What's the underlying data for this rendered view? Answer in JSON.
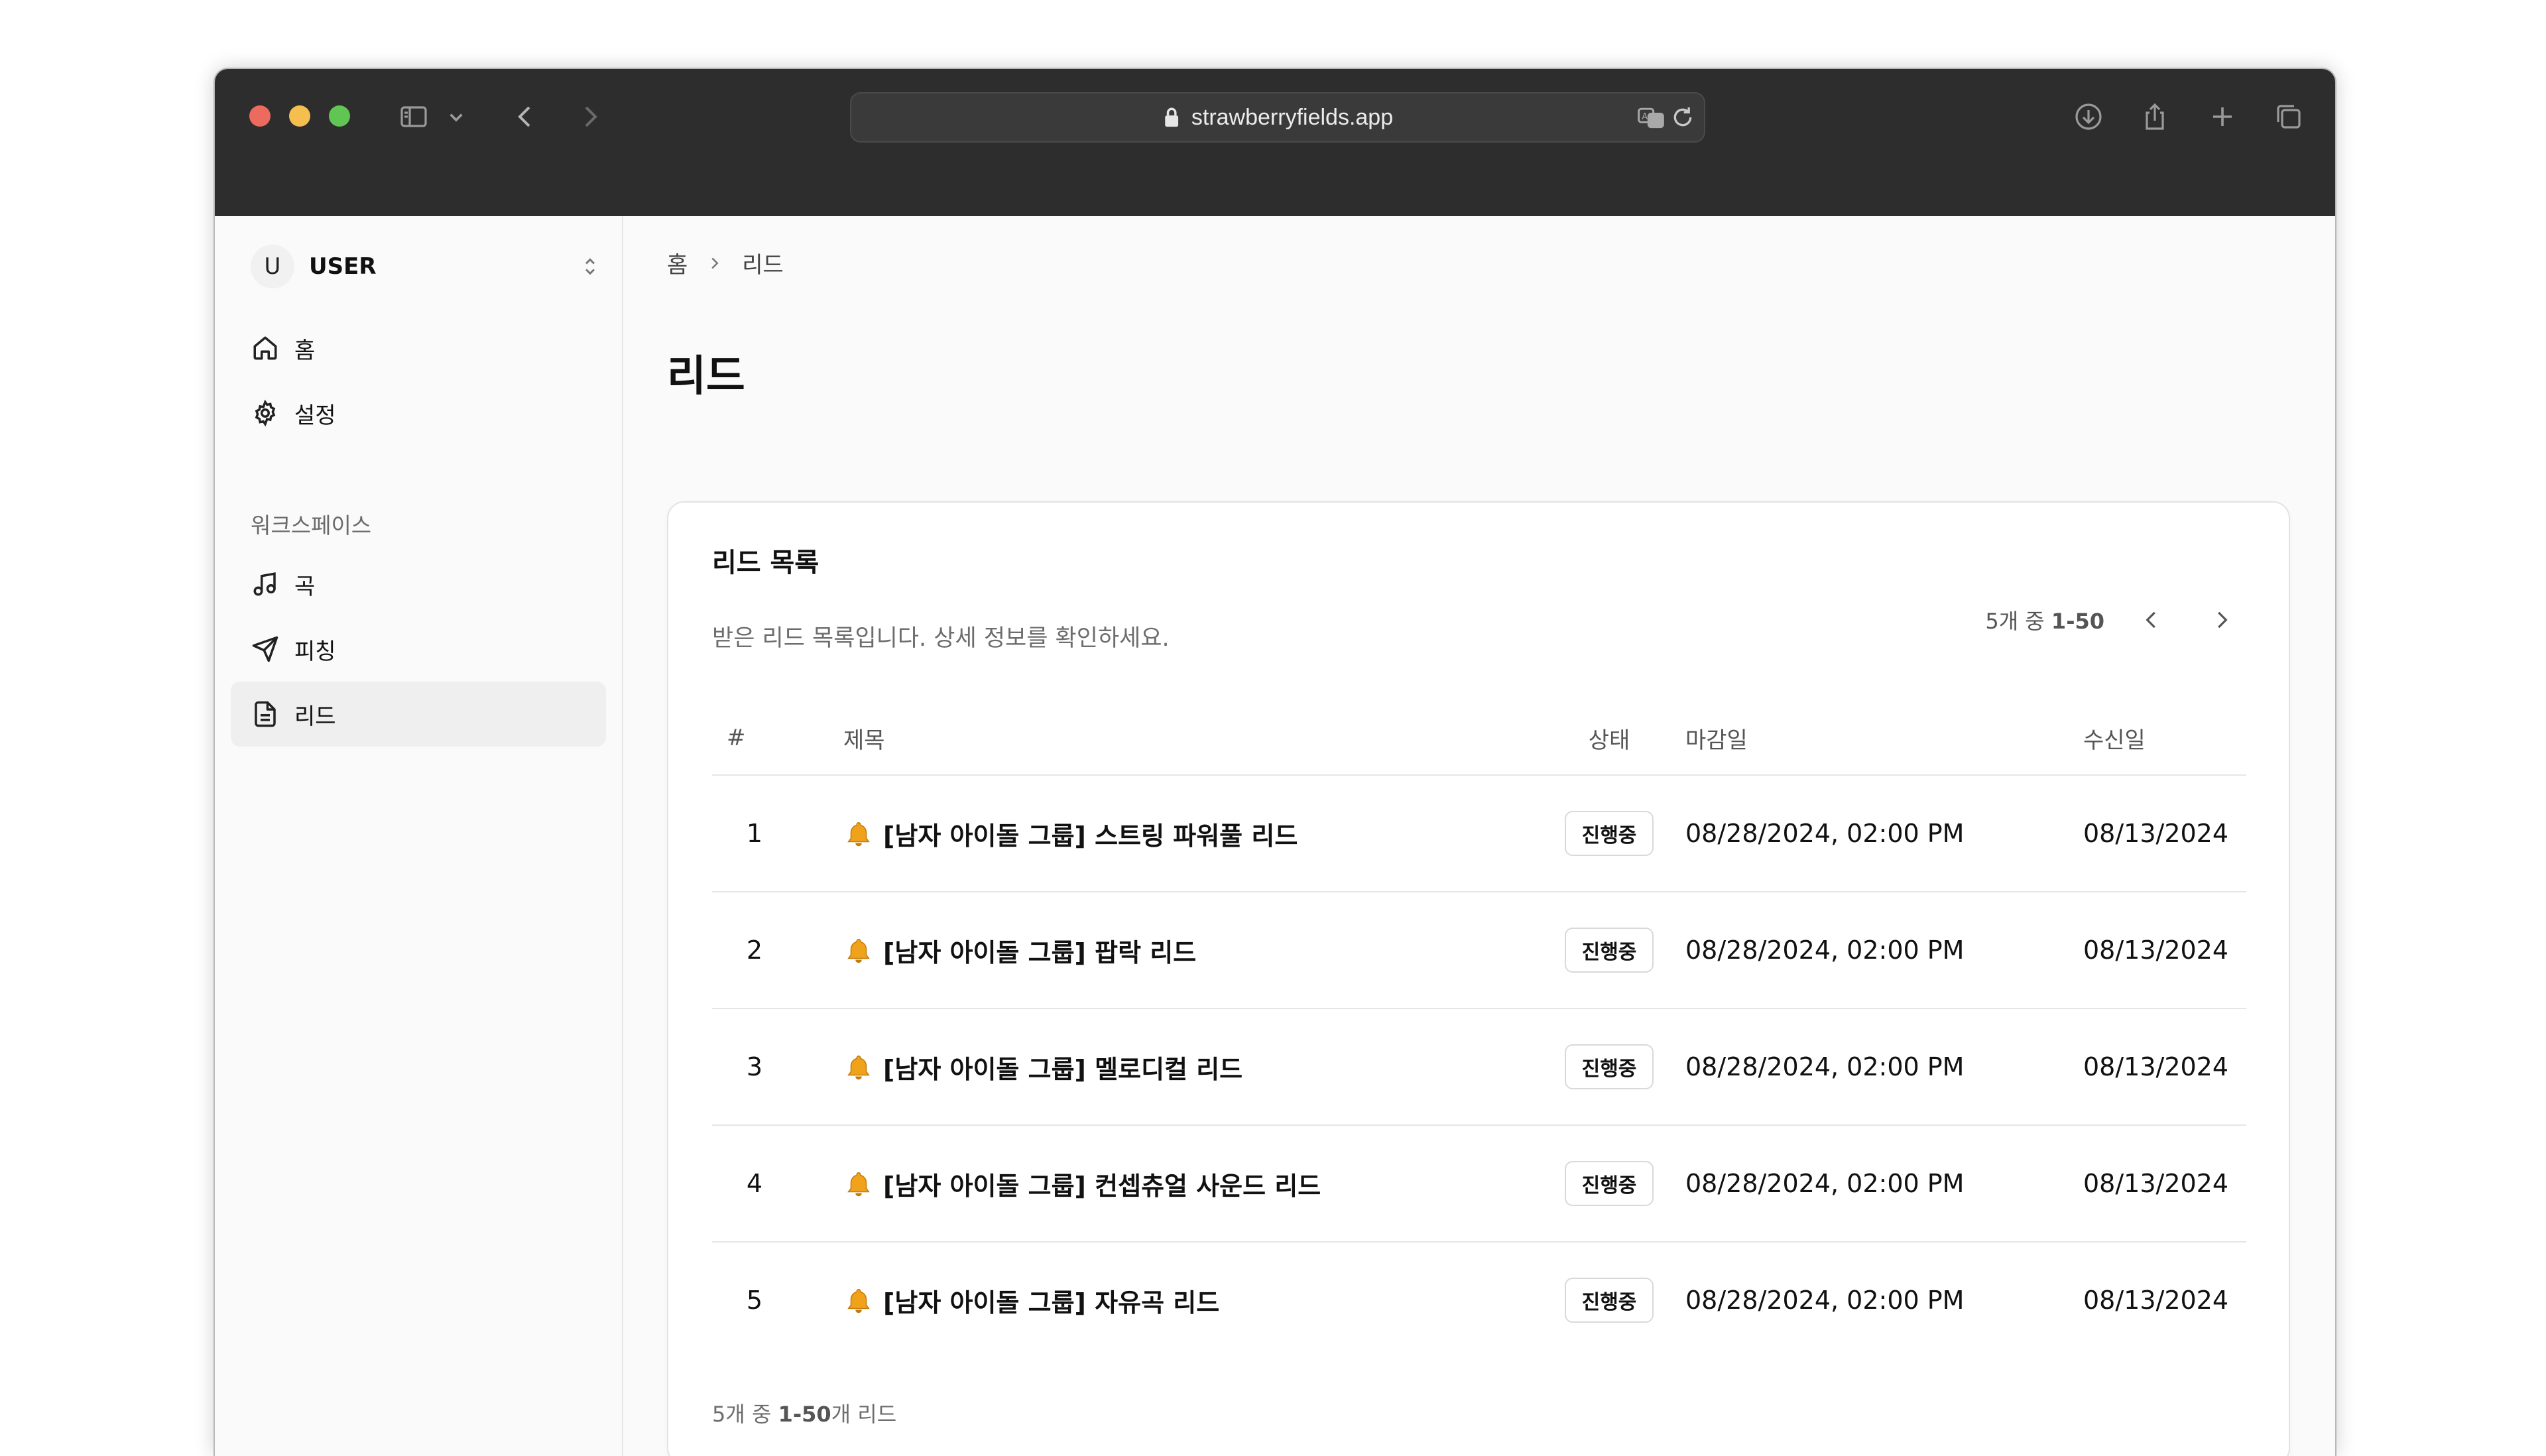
{
  "browser": {
    "url": "strawberryfields.app",
    "traffic_lights": {
      "close": "#ed6a5e",
      "minimize": "#f5bf4f",
      "zoom": "#61c554"
    }
  },
  "sidebar": {
    "user_initial": "U",
    "user_name": "USER",
    "items": [
      {
        "label": "홈",
        "icon": "home-icon"
      },
      {
        "label": "설정",
        "icon": "gear-icon"
      }
    ],
    "section_label": "워크스페이스",
    "workspace_items": [
      {
        "label": "곡",
        "icon": "music-note-icon"
      },
      {
        "label": "피칭",
        "icon": "send-icon"
      },
      {
        "label": "리드",
        "icon": "document-icon",
        "active": true
      }
    ]
  },
  "main": {
    "breadcrumb": [
      "홈",
      "리드"
    ],
    "page_title": "리드",
    "card": {
      "title": "리드 목록",
      "description": "받은 리드 목록입니다. 상세 정보를 확인하세요.",
      "pager_text": "5개 중",
      "pager_range": "1-50",
      "columns": [
        "#",
        "제목",
        "상태",
        "마감일",
        "수신일"
      ],
      "rows": [
        {
          "num": "1",
          "title": "[남자 아이돌 그룹] 스트링 파워풀 리드",
          "status": "진행중",
          "deadline": "08/28/2024, 02:00 PM",
          "received": "08/13/2024"
        },
        {
          "num": "2",
          "title": "[남자 아이돌 그룹] 팝락 리드",
          "status": "진행중",
          "deadline": "08/28/2024, 02:00 PM",
          "received": "08/13/2024"
        },
        {
          "num": "3",
          "title": "[남자 아이돌 그룹] 멜로디컬 리드",
          "status": "진행중",
          "deadline": "08/28/2024, 02:00 PM",
          "received": "08/13/2024"
        },
        {
          "num": "4",
          "title": "[남자 아이돌 그룹] 컨셉츄얼 사운드 리드",
          "status": "진행중",
          "deadline": "08/28/2024, 02:00 PM",
          "received": "08/13/2024"
        },
        {
          "num": "5",
          "title": "[남자 아이돌 그룹] 자유곡 리드",
          "status": "진행중",
          "deadline": "08/28/2024, 02:00 PM",
          "received": "08/13/2024"
        }
      ],
      "footer_count": "5개 중",
      "footer_range": "1-50",
      "footer_suffix": "개 리드"
    }
  }
}
